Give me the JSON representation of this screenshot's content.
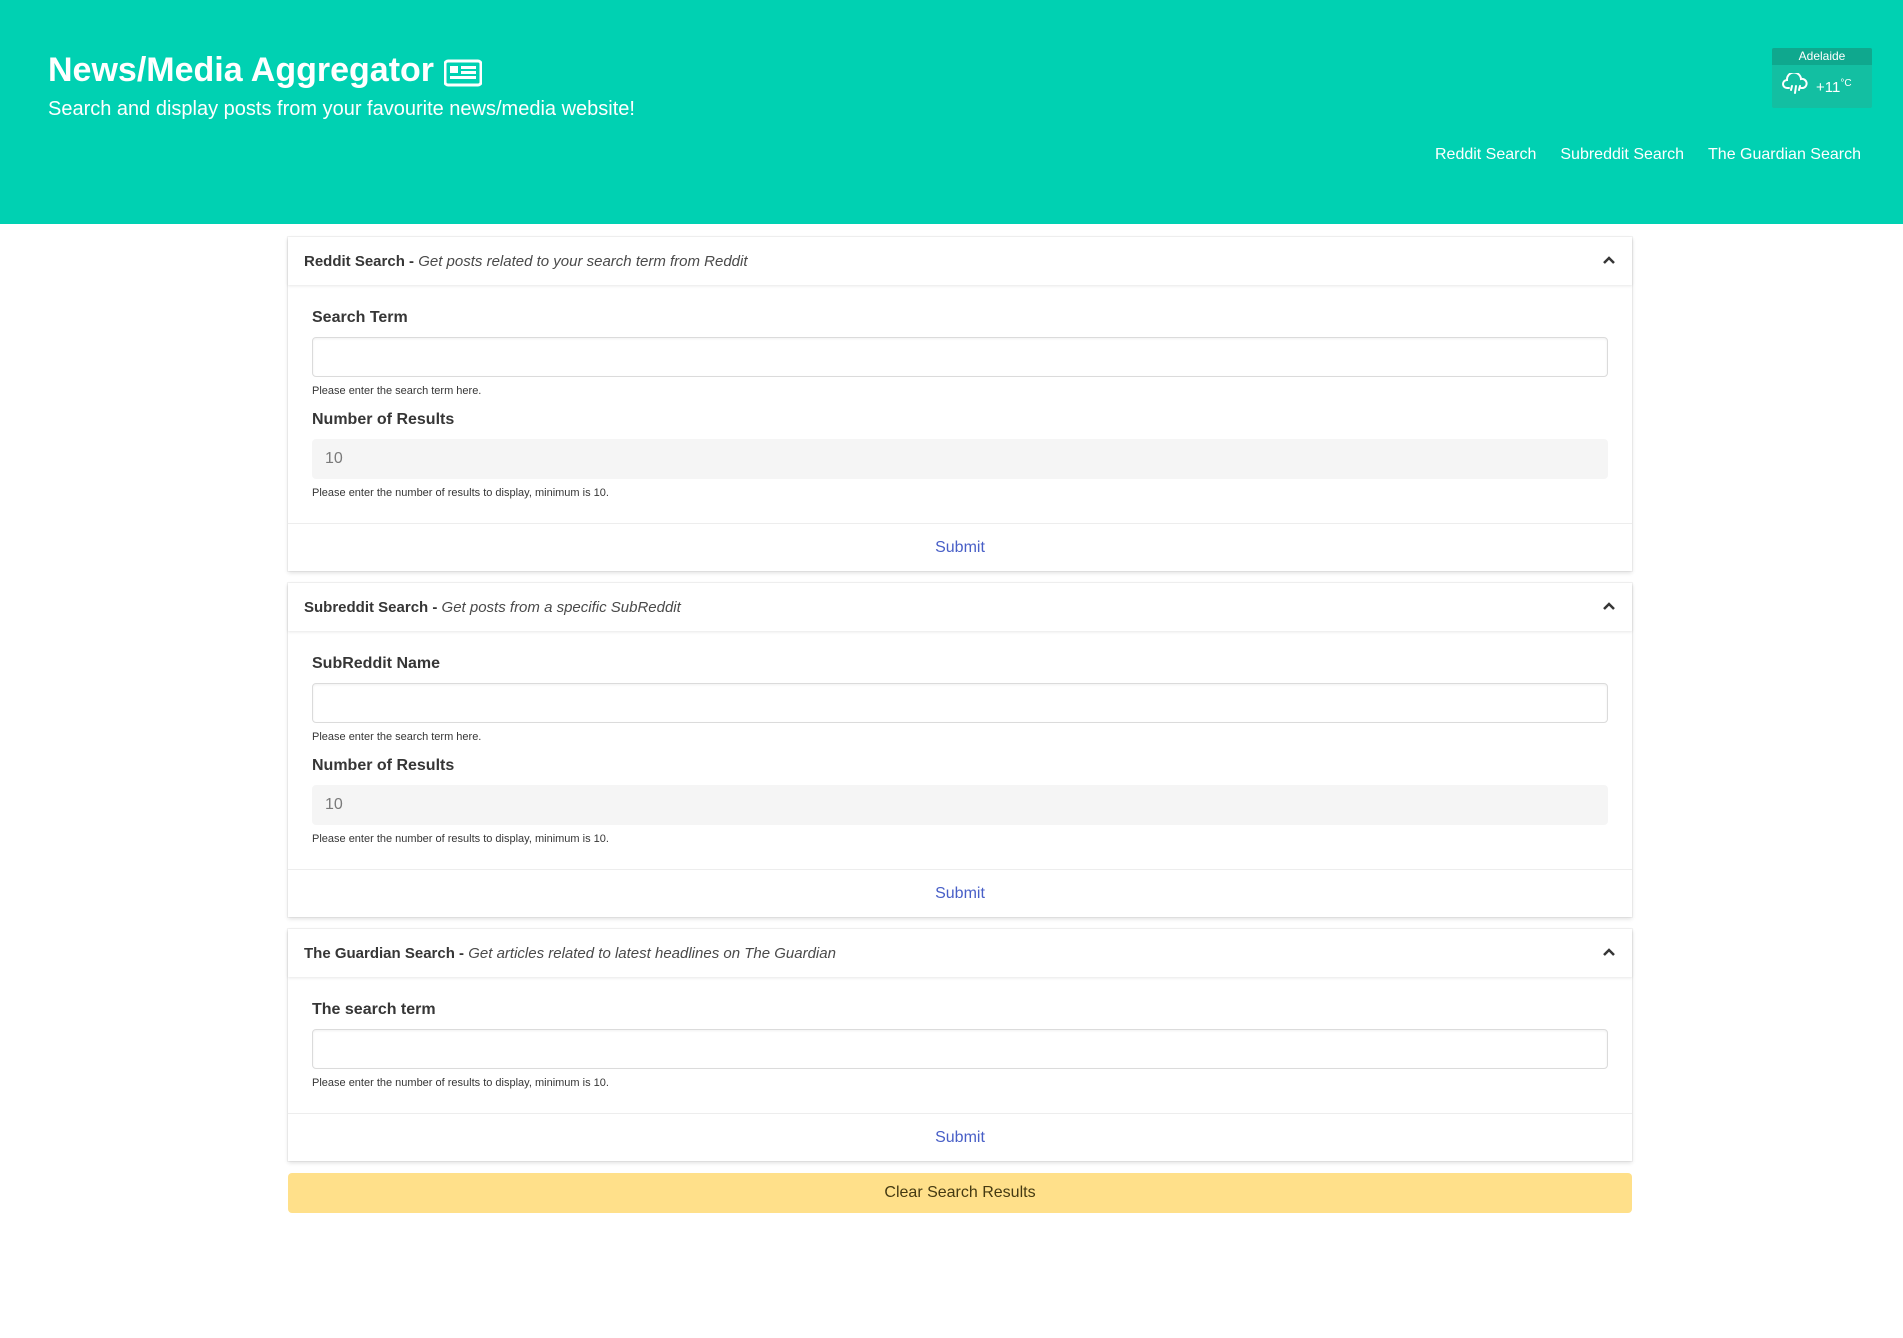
{
  "header": {
    "title": "News/Media Aggregator",
    "subtitle": "Search and display posts from your favourite news/media website!",
    "weather": {
      "city": "Adelaide",
      "temp": "+11",
      "unit": "°C",
      "icon": "cloud-rain-icon"
    },
    "nav": [
      "Reddit Search",
      "Subreddit Search",
      "The Guardian Search"
    ]
  },
  "reddit": {
    "title": "Reddit Search -",
    "desc": "Get posts related to your search term from Reddit",
    "field1_label": "Search Term",
    "field1_value": "",
    "field1_help": "Please enter the search term here.",
    "field2_label": "Number of Results",
    "field2_value": "10",
    "field2_help": "Please enter the number of results to display, minimum is 10.",
    "submit": "Submit"
  },
  "subreddit": {
    "title": "Subreddit Search -",
    "desc": "Get posts from a specific SubReddit",
    "field1_label": "SubReddit Name",
    "field1_value": "",
    "field1_help": "Please enter the search term here.",
    "field2_label": "Number of Results",
    "field2_value": "10",
    "field2_help": "Please enter the number of results to display, minimum is 10.",
    "submit": "Submit"
  },
  "guardian": {
    "title": "The Guardian Search -",
    "desc": "Get articles related to latest headlines on The Guardian",
    "field1_label": "The search term",
    "field1_value": "",
    "field1_help": "Please enter the number of results to display, minimum is 10.",
    "submit": "Submit"
  },
  "clear_label": "Clear Search Results",
  "colors": {
    "primary": "#00d1b2",
    "warning": "#ffe08a",
    "link": "#485fc7"
  }
}
